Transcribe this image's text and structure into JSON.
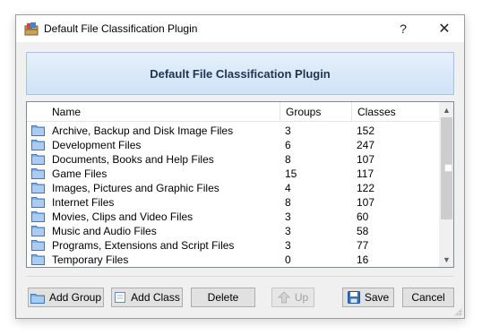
{
  "window": {
    "title": "Default File Classification Plugin",
    "help_label": "?",
    "close_label": "✕"
  },
  "banner": {
    "title": "Default File Classification Plugin"
  },
  "list": {
    "columns": {
      "name": "Name",
      "groups": "Groups",
      "classes": "Classes"
    },
    "rows": [
      {
        "name": "Archive, Backup and Disk Image Files",
        "groups": "3",
        "classes": "152"
      },
      {
        "name": "Development Files",
        "groups": "6",
        "classes": "247"
      },
      {
        "name": "Documents, Books and Help Files",
        "groups": "8",
        "classes": "107"
      },
      {
        "name": "Game Files",
        "groups": "15",
        "classes": "117"
      },
      {
        "name": "Images, Pictures and Graphic Files",
        "groups": "4",
        "classes": "122"
      },
      {
        "name": "Internet Files",
        "groups": "8",
        "classes": "107"
      },
      {
        "name": "Movies, Clips and Video Files",
        "groups": "3",
        "classes": "60"
      },
      {
        "name": "Music and Audio Files",
        "groups": "3",
        "classes": "58"
      },
      {
        "name": "Programs, Extensions and Script Files",
        "groups": "3",
        "classes": "77"
      },
      {
        "name": "Temporary Files",
        "groups": "0",
        "classes": "16"
      }
    ],
    "row_icon": "folder-icon"
  },
  "buttons": {
    "add_group": "Add Group",
    "add_class": "Add Class",
    "delete": "Delete",
    "up": "Up",
    "save": "Save",
    "cancel": "Cancel"
  },
  "colors": {
    "banner_bg": "#d8e8f8",
    "banner_text": "#1f3550",
    "folder": "#7fb2e5",
    "disabled_text": "#a0a0a0"
  }
}
